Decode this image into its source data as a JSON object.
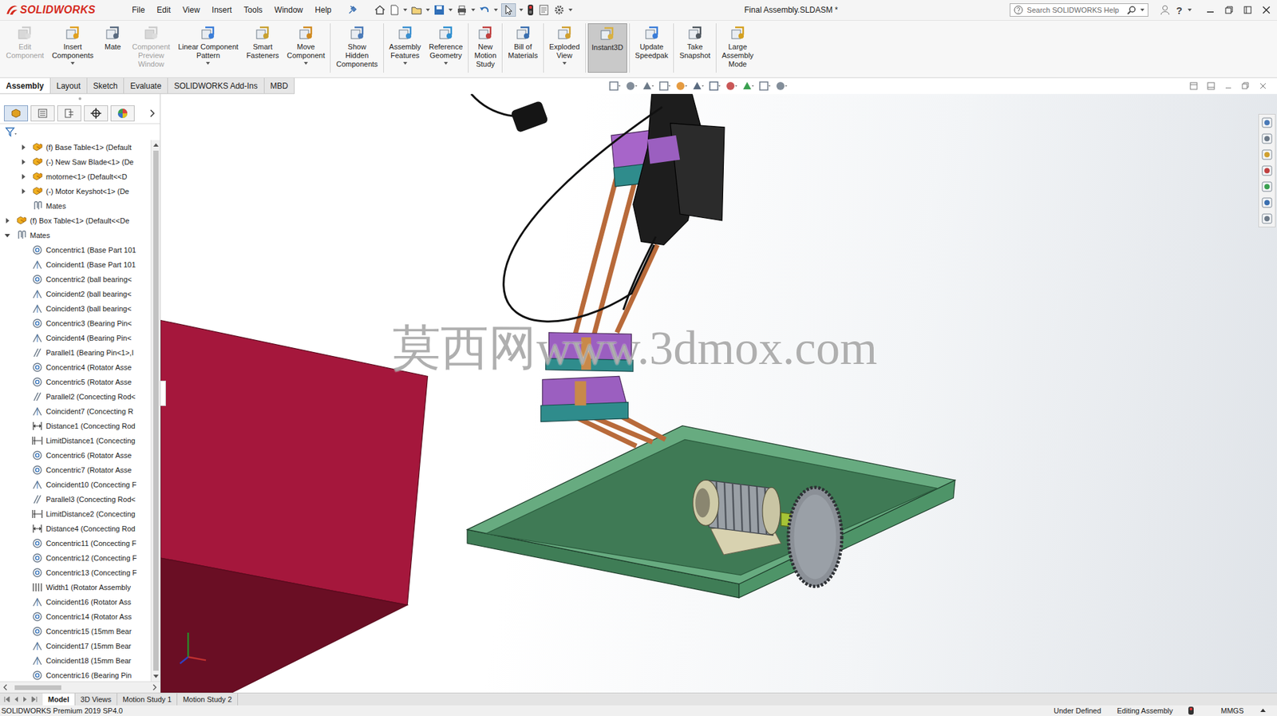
{
  "app": {
    "logo": "SOLIDWORKS",
    "title": "Final Assembly.SLDASM *",
    "search_placeholder": "Search SOLIDWORKS Help",
    "help_label": "?"
  },
  "menus": [
    "File",
    "Edit",
    "View",
    "Insert",
    "Tools",
    "Window",
    "Help"
  ],
  "ribbon": {
    "groups": [
      [
        {
          "lines": [
            "Edit",
            "Component"
          ],
          "disabled": true,
          "dropdown": false,
          "selected": false
        },
        {
          "lines": [
            "Insert",
            "Components"
          ],
          "disabled": false,
          "dropdown": true,
          "selected": false
        },
        {
          "lines": [
            "Mate"
          ],
          "disabled": false,
          "dropdown": false,
          "selected": false
        },
        {
          "lines": [
            "Component",
            "Preview",
            "Window"
          ],
          "disabled": true,
          "dropdown": false,
          "selected": false
        },
        {
          "lines": [
            "Linear Component",
            "Pattern"
          ],
          "disabled": false,
          "dropdown": true,
          "selected": false
        },
        {
          "lines": [
            "Smart",
            "Fasteners"
          ],
          "disabled": false,
          "dropdown": false,
          "selected": false
        },
        {
          "lines": [
            "Move",
            "Component"
          ],
          "disabled": false,
          "dropdown": true,
          "selected": false
        }
      ],
      [
        {
          "lines": [
            "Show",
            "Hidden",
            "Components"
          ],
          "disabled": false,
          "dropdown": false,
          "selected": false
        }
      ],
      [
        {
          "lines": [
            "Assembly",
            "Features"
          ],
          "disabled": false,
          "dropdown": true,
          "selected": false
        },
        {
          "lines": [
            "Reference",
            "Geometry"
          ],
          "disabled": false,
          "dropdown": true,
          "selected": false
        }
      ],
      [
        {
          "lines": [
            "New",
            "Motion",
            "Study"
          ],
          "disabled": false,
          "dropdown": false,
          "selected": false
        }
      ],
      [
        {
          "lines": [
            "Bill of",
            "Materials"
          ],
          "disabled": false,
          "dropdown": false,
          "selected": false
        }
      ],
      [
        {
          "lines": [
            "Exploded",
            "View"
          ],
          "disabled": false,
          "dropdown": true,
          "selected": false
        }
      ],
      [
        {
          "lines": [
            "Instant3D"
          ],
          "disabled": false,
          "dropdown": false,
          "selected": true
        }
      ],
      [
        {
          "lines": [
            "Update",
            "Speedpak"
          ],
          "disabled": false,
          "dropdown": false,
          "selected": false
        }
      ],
      [
        {
          "lines": [
            "Take",
            "Snapshot"
          ],
          "disabled": false,
          "dropdown": false,
          "selected": false
        }
      ],
      [
        {
          "lines": [
            "Large",
            "Assembly",
            "Mode"
          ],
          "disabled": false,
          "dropdown": false,
          "selected": false
        }
      ]
    ]
  },
  "tabs": [
    {
      "label": "Assembly",
      "selected": true
    },
    {
      "label": "Layout",
      "selected": false
    },
    {
      "label": "Sketch",
      "selected": false
    },
    {
      "label": "Evaluate",
      "selected": false
    },
    {
      "label": "SOLIDWORKS Add-Ins",
      "selected": false
    },
    {
      "label": "MBD",
      "selected": false
    }
  ],
  "tree": [
    {
      "label": "(f) Base Table<1> (Default",
      "kind": "component",
      "depth": 1,
      "has_children": true,
      "expanded": false
    },
    {
      "label": "(-) New Saw Blade<1> (De",
      "kind": "component",
      "depth": 1,
      "has_children": true,
      "expanded": false
    },
    {
      "label": "motorne<1> (Default<<D",
      "kind": "component",
      "depth": 1,
      "has_children": true,
      "expanded": false
    },
    {
      "label": "(-) Motor Keyshot<1> (De",
      "kind": "component",
      "depth": 1,
      "has_children": true,
      "expanded": false
    },
    {
      "label": "Mates",
      "kind": "mates",
      "depth": 1,
      "has_children": false,
      "expanded": false
    },
    {
      "label": "(f) Box Table<1> (Default<<De",
      "kind": "component",
      "depth": 0,
      "has_children": true,
      "expanded": false
    },
    {
      "label": "Mates",
      "kind": "mates",
      "depth": 0,
      "has_children": true,
      "expanded": true
    },
    {
      "label": "Concentric1 (Base Part 101",
      "kind": "concentric",
      "depth": 1,
      "has_children": false,
      "expanded": false
    },
    {
      "label": "Coincident1 (Base Part 101",
      "kind": "coincident",
      "depth": 1,
      "has_children": false,
      "expanded": false
    },
    {
      "label": "Concentric2 (ball bearing<",
      "kind": "concentric",
      "depth": 1,
      "has_children": false,
      "expanded": false
    },
    {
      "label": "Coincident2 (ball bearing<",
      "kind": "coincident",
      "depth": 1,
      "has_children": false,
      "expanded": false
    },
    {
      "label": "Coincident3 (ball bearing<",
      "kind": "coincident",
      "depth": 1,
      "has_children": false,
      "expanded": false
    },
    {
      "label": "Concentric3 (Bearing Pin<",
      "kind": "concentric",
      "depth": 1,
      "has_children": false,
      "expanded": false
    },
    {
      "label": "Coincident4 (Bearing Pin<",
      "kind": "coincident",
      "depth": 1,
      "has_children": false,
      "expanded": false
    },
    {
      "label": "Parallel1 (Bearing Pin<1>,I",
      "kind": "parallel",
      "depth": 1,
      "has_children": false,
      "expanded": false
    },
    {
      "label": "Concentric4 (Rotator Asse",
      "kind": "concentric",
      "depth": 1,
      "has_children": false,
      "expanded": false
    },
    {
      "label": "Concentric5 (Rotator Asse",
      "kind": "concentric",
      "depth": 1,
      "has_children": false,
      "expanded": false
    },
    {
      "label": "Parallel2 (Concecting Rod<",
      "kind": "parallel",
      "depth": 1,
      "has_children": false,
      "expanded": false
    },
    {
      "label": "Coincident7 (Concecting R",
      "kind": "coincident",
      "depth": 1,
      "has_children": false,
      "expanded": false
    },
    {
      "label": "Distance1 (Concecting Rod",
      "kind": "distance",
      "depth": 1,
      "has_children": false,
      "expanded": false
    },
    {
      "label": "LimitDistance1 (Concecting",
      "kind": "limitdistance",
      "depth": 1,
      "has_children": false,
      "expanded": false
    },
    {
      "label": "Concentric6 (Rotator Asse",
      "kind": "concentric",
      "depth": 1,
      "has_children": false,
      "expanded": false
    },
    {
      "label": "Concentric7 (Rotator Asse",
      "kind": "concentric",
      "depth": 1,
      "has_children": false,
      "expanded": false
    },
    {
      "label": "Coincident10 (Concecting F",
      "kind": "coincident",
      "depth": 1,
      "has_children": false,
      "expanded": false
    },
    {
      "label": "Parallel3 (Concecting Rod<",
      "kind": "parallel",
      "depth": 1,
      "has_children": false,
      "expanded": false
    },
    {
      "label": "LimitDistance2 (Concecting",
      "kind": "limitdistance",
      "depth": 1,
      "has_children": false,
      "expanded": false
    },
    {
      "label": "Distance4 (Concecting Rod",
      "kind": "distance",
      "depth": 1,
      "has_children": false,
      "expanded": false
    },
    {
      "label": "Concentric11 (Concecting F",
      "kind": "concentric",
      "depth": 1,
      "has_children": false,
      "expanded": false
    },
    {
      "label": "Concentric12 (Concecting F",
      "kind": "concentric",
      "depth": 1,
      "has_children": false,
      "expanded": false
    },
    {
      "label": "Concentric13 (Concecting F",
      "kind": "concentric",
      "depth": 1,
      "has_children": false,
      "expanded": false
    },
    {
      "label": "Width1 (Rotator Assembly",
      "kind": "width",
      "depth": 1,
      "has_children": false,
      "expanded": false
    },
    {
      "label": "Coincident16 (Rotator Ass",
      "kind": "coincident",
      "depth": 1,
      "has_children": false,
      "expanded": false
    },
    {
      "label": "Concentric14 (Rotator Ass",
      "kind": "concentric",
      "depth": 1,
      "has_children": false,
      "expanded": false
    },
    {
      "label": "Concentric15 (15mm Bear",
      "kind": "concentric",
      "depth": 1,
      "has_children": false,
      "expanded": false
    },
    {
      "label": "Coincident17 (15mm Bear",
      "kind": "coincident",
      "depth": 1,
      "has_children": false,
      "expanded": false
    },
    {
      "label": "Coincident18 (15mm Bear",
      "kind": "coincident",
      "depth": 1,
      "has_children": false,
      "expanded": false
    },
    {
      "label": "Concentric16 (Bearing Pin",
      "kind": "concentric",
      "depth": 1,
      "has_children": false,
      "expanded": false
    }
  ],
  "watermark": "莫西网www.3dmox.com",
  "bottom_tabs": [
    {
      "label": "Model",
      "selected": true
    },
    {
      "label": "3D Views",
      "selected": false
    },
    {
      "label": "Motion Study 1",
      "selected": false
    },
    {
      "label": "Motion Study 2",
      "selected": false
    }
  ],
  "status_bar": {
    "product": "SOLIDWORKS Premium 2019 SP4.0",
    "state": "Under Defined",
    "mode": "Editing Assembly",
    "units": "MMGS"
  }
}
